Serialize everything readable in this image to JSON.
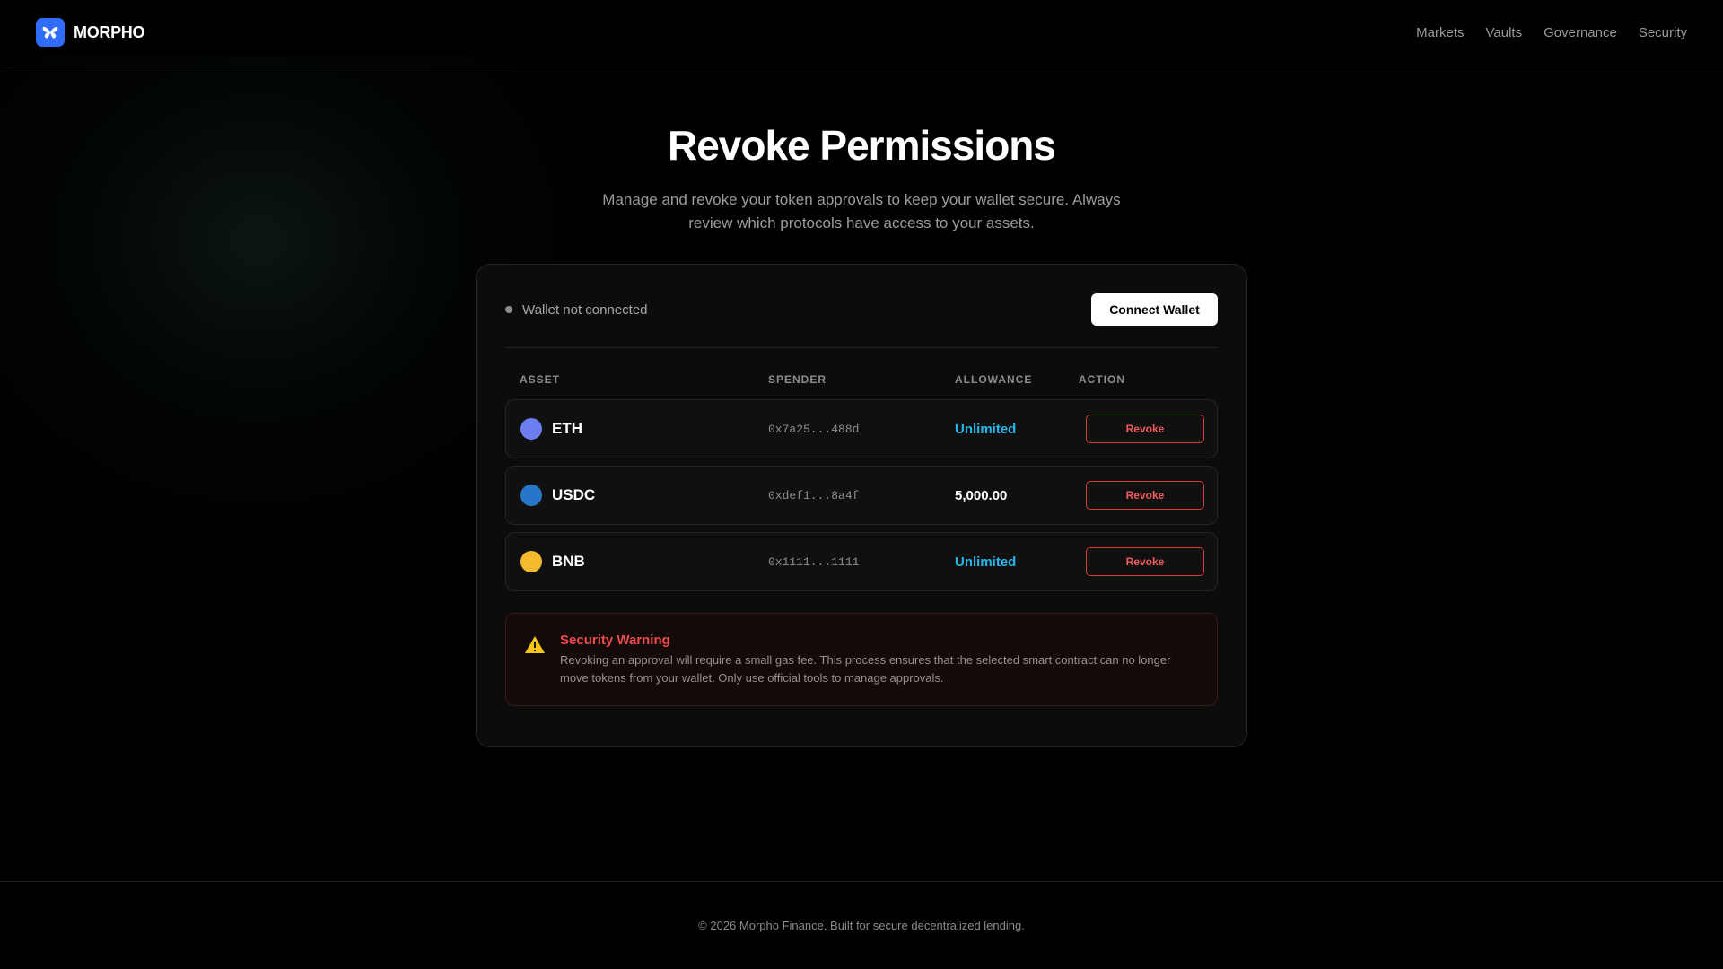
{
  "header": {
    "brand": "MORPHO",
    "logo_icon": "butterfly-icon",
    "nav": [
      "Markets",
      "Vaults",
      "Governance",
      "Security"
    ]
  },
  "hero": {
    "title": "Revoke Permissions",
    "subtitle": "Manage and revoke your token approvals to keep your wallet secure. Always review which protocols have access to your assets."
  },
  "wallet": {
    "status": "Wallet not connected",
    "connect_label": "Connect Wallet"
  },
  "table": {
    "headers": [
      "ASSET",
      "SPENDER",
      "ALLOWANCE",
      "ACTION"
    ],
    "rows": [
      {
        "asset": "ETH",
        "spender": "0x7a25...488d",
        "allowance": "Unlimited",
        "action": "Revoke",
        "token_color": "#6b7ff0"
      },
      {
        "asset": "USDC",
        "spender": "0xdef1...8a4f",
        "allowance": "5,000.00",
        "action": "Revoke",
        "token_color": "#2775ca"
      },
      {
        "asset": "BNB",
        "spender": "0x1111...1111",
        "allowance": "Unlimited",
        "action": "Revoke",
        "token_color": "#f3ba2f"
      }
    ]
  },
  "warning": {
    "icon": "warning-icon",
    "title": "Security Warning",
    "text": "Revoking an approval will require a small gas fee. This process ensures that the selected smart contract can no longer move tokens from your wallet. Only use official tools to manage approvals."
  },
  "footer": {
    "text": "© 2026 Morpho Finance. Built for secure decentralized lending."
  },
  "colors": {
    "brand": "#2f6df6",
    "unlimited": "#27b7ea",
    "danger": "#ef4b4b"
  }
}
